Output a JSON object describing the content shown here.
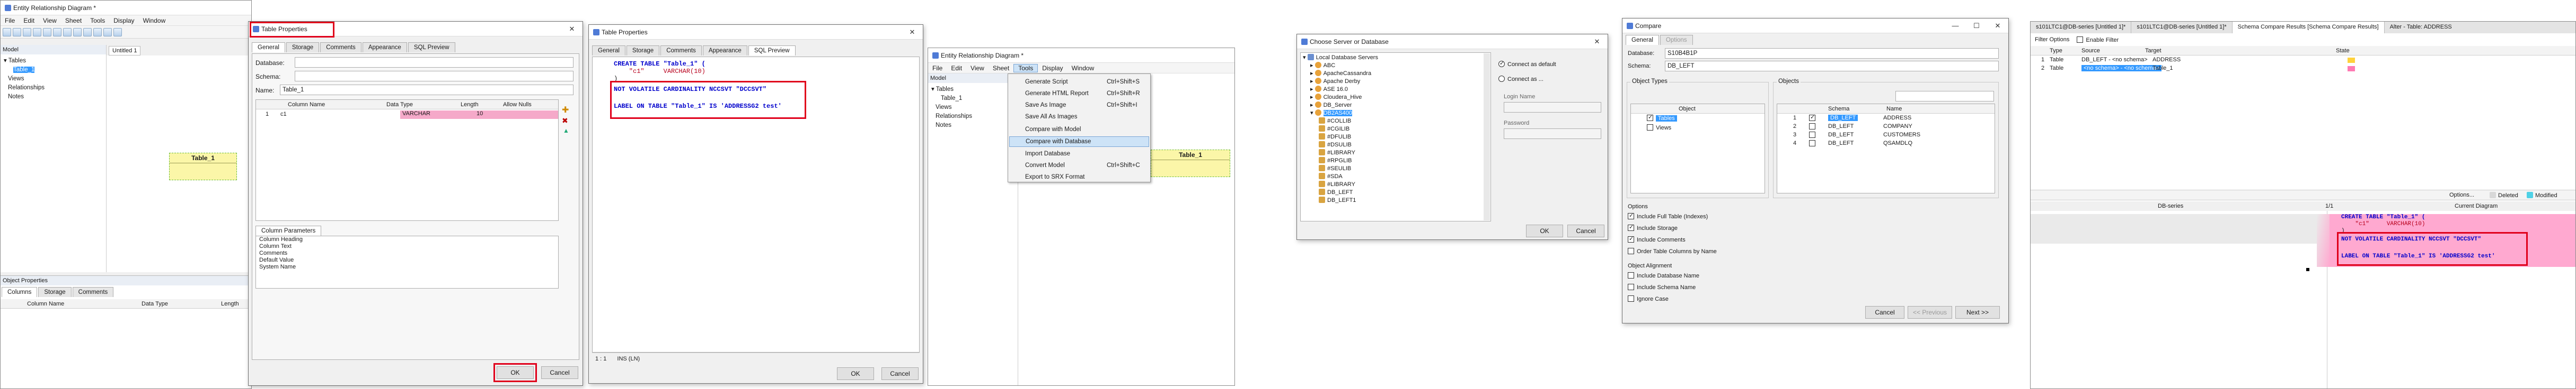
{
  "erd1": {
    "title": "Entity Relationship Diagram *",
    "menu": [
      "File",
      "Edit",
      "View",
      "Sheet",
      "Tools",
      "Display",
      "Window"
    ],
    "model_label": "Model",
    "doc_tab": "Untitled 1",
    "tree": [
      "Tables",
      "Table_1",
      "Views",
      "Relationships",
      "Notes"
    ],
    "entity_name": "Table_1",
    "props_title": "Object Properties",
    "props_tabs": [
      "Columns",
      "Storage",
      "Comments"
    ],
    "props_cols": [
      "Column Name",
      "Data Type",
      "Length"
    ]
  },
  "tp1": {
    "title": "Table Properties",
    "tabs": [
      "General",
      "Storage",
      "Comments",
      "Appearance",
      "SQL Preview"
    ],
    "database_label": "Database:",
    "schema_label": "Schema:",
    "name_label": "Name:",
    "name_value": "Table_1",
    "grid_headers": [
      "",
      "Column Name",
      "Data Type",
      "Length",
      "Allow Nulls"
    ],
    "row_num": "1",
    "row_name": "c1",
    "row_type": "VARCHAR",
    "row_len": "10",
    "params_tab": "Column Parameters",
    "params": [
      "Column Heading",
      "Column Text",
      "Comments",
      "Default Value",
      "System Name"
    ],
    "ok": "OK",
    "cancel": "Cancel"
  },
  "tp2": {
    "title": "Table Properties",
    "tabs": [
      "General",
      "Storage",
      "Comments",
      "Appearance",
      "SQL Preview"
    ],
    "sql1": "CREATE TABLE \"Table_1\" (",
    "sql2": "    \"c1\"     VARCHAR(10)",
    "sql3": ")",
    "sql4": "NOT VOLATILE CARDINALITY NCCSVT \"DCCSVT\"",
    "sql5": "LABEL ON TABLE \"Table_1\" IS 'ADDRESSG2 test'",
    "status": [
      "1 : 1",
      "INS  (LN)"
    ],
    "ok": "OK",
    "cancel": "Cancel"
  },
  "erd2": {
    "title": "Entity Relationship Diagram *",
    "menu": [
      "File",
      "Edit",
      "View",
      "Sheet",
      "Tools",
      "Display",
      "Window"
    ],
    "model_label": "Model",
    "tree": [
      "Tables",
      "Table_1",
      "Views",
      "Relationships",
      "Notes"
    ],
    "tools_menu": [
      {
        "label": "Generate Script",
        "key": "Ctrl+Shift+S"
      },
      {
        "label": "Generate HTML Report",
        "key": "Ctrl+Shift+R"
      },
      {
        "label": "Save As Image",
        "key": "Ctrl+Shift+I"
      },
      {
        "label": "Save All As Images",
        "key": ""
      },
      {
        "label": "Compare with Model",
        "key": ""
      },
      {
        "label": "Compare with Database",
        "key": ""
      },
      {
        "label": "Import Database",
        "key": ""
      },
      {
        "label": "Convert Model",
        "key": "Ctrl+Shift+C"
      },
      {
        "label": "Export to SRX Format",
        "key": ""
      }
    ],
    "entity_name": "Table_1"
  },
  "csd": {
    "title": "Choose Server or Database",
    "root": "Local Database Servers",
    "servers": [
      "ABC",
      "ApacheCassandra",
      "Apache Derby",
      "ASE 16.0",
      "Cloudera_Hive",
      "DB_Server",
      "DB2AS400"
    ],
    "dbs": [
      "#COLLIB",
      "#CGILIB",
      "#DFULIB",
      "#DSULIB",
      "#LIBRARY",
      "#RPGLIB",
      "#SEULIB",
      "#SDA",
      "#LIBRARY",
      "DB_LEFT",
      "DB_LEFT1"
    ],
    "connect_default": "Connect as default",
    "connect_as": "Connect as ...",
    "login_label": "Login Name",
    "password_label": "Password",
    "ok": "OK",
    "cancel": "Cancel"
  },
  "cmp": {
    "title": "Compare",
    "tabs": [
      "General",
      "Options"
    ],
    "database_label": "Database:",
    "database_value": "S10B4B1P",
    "schema_label": "Schema:",
    "schema_value": "DB_LEFT",
    "object_types_label": "Object Types",
    "object_types": [
      "Tables",
      "Views"
    ],
    "objects_label": "Objects",
    "obj_headers": [
      "",
      "Schema",
      "Name"
    ],
    "objects": [
      {
        "schema": "DB_LEFT",
        "name": "ADDRESS"
      },
      {
        "schema": "DB_LEFT",
        "name": "COMPANY"
      },
      {
        "schema": "DB_LEFT",
        "name": "CUSTOMERS"
      },
      {
        "schema": "DB_LEFT",
        "name": "QSAMDLQ"
      }
    ],
    "options_label": "Options",
    "options": [
      "Include Full Table (Indexes)",
      "Include Storage",
      "Include Comments",
      "Order Table Columns by Name"
    ],
    "alignment_label": "Object Alignment",
    "alignment": [
      "Include Database Name",
      "Include Schema Name",
      "Ignore Case"
    ],
    "cancel": "Cancel",
    "prev": "<< Previous",
    "next": "Next >>"
  },
  "scr": {
    "tabs": [
      "s101LTC1@DB-series [Untitled 1]*",
      "s101LTC1@DB-series [Untitled 1]*",
      "Schema Compare Results [Schema Compare Results]",
      "Alter - Table: ADDRESS"
    ],
    "filter_options": "Filter Options",
    "enable_filter": "Enable Filter",
    "headers": [
      "",
      "Type",
      "Source",
      "Target",
      "State"
    ],
    "rows": [
      {
        "num": "1",
        "type": "Table",
        "source": "DB_LEFT - <no schema>",
        "target": "ADDRESS"
      },
      {
        "num": "2",
        "type": "Table",
        "source": "<no schema> - <no schema>",
        "target": "Table_1"
      }
    ],
    "options_btn": "Options...",
    "legend": [
      "Deleted",
      "Modified"
    ],
    "left_title": "DB-series",
    "right_title": "Current Diagram",
    "ratio": "1/1",
    "sql1": "CREATE TABLE \"Table_1\" (",
    "sql2": "    \"c1\"     VARCHAR(10)",
    "sql3": ")",
    "sql4": "NOT VOLATILE CARDINALITY NCCSVT \"DCCSVT\"",
    "sql5": "LABEL ON TABLE \"Table_1\" IS 'ADDRESSG2 test'"
  }
}
